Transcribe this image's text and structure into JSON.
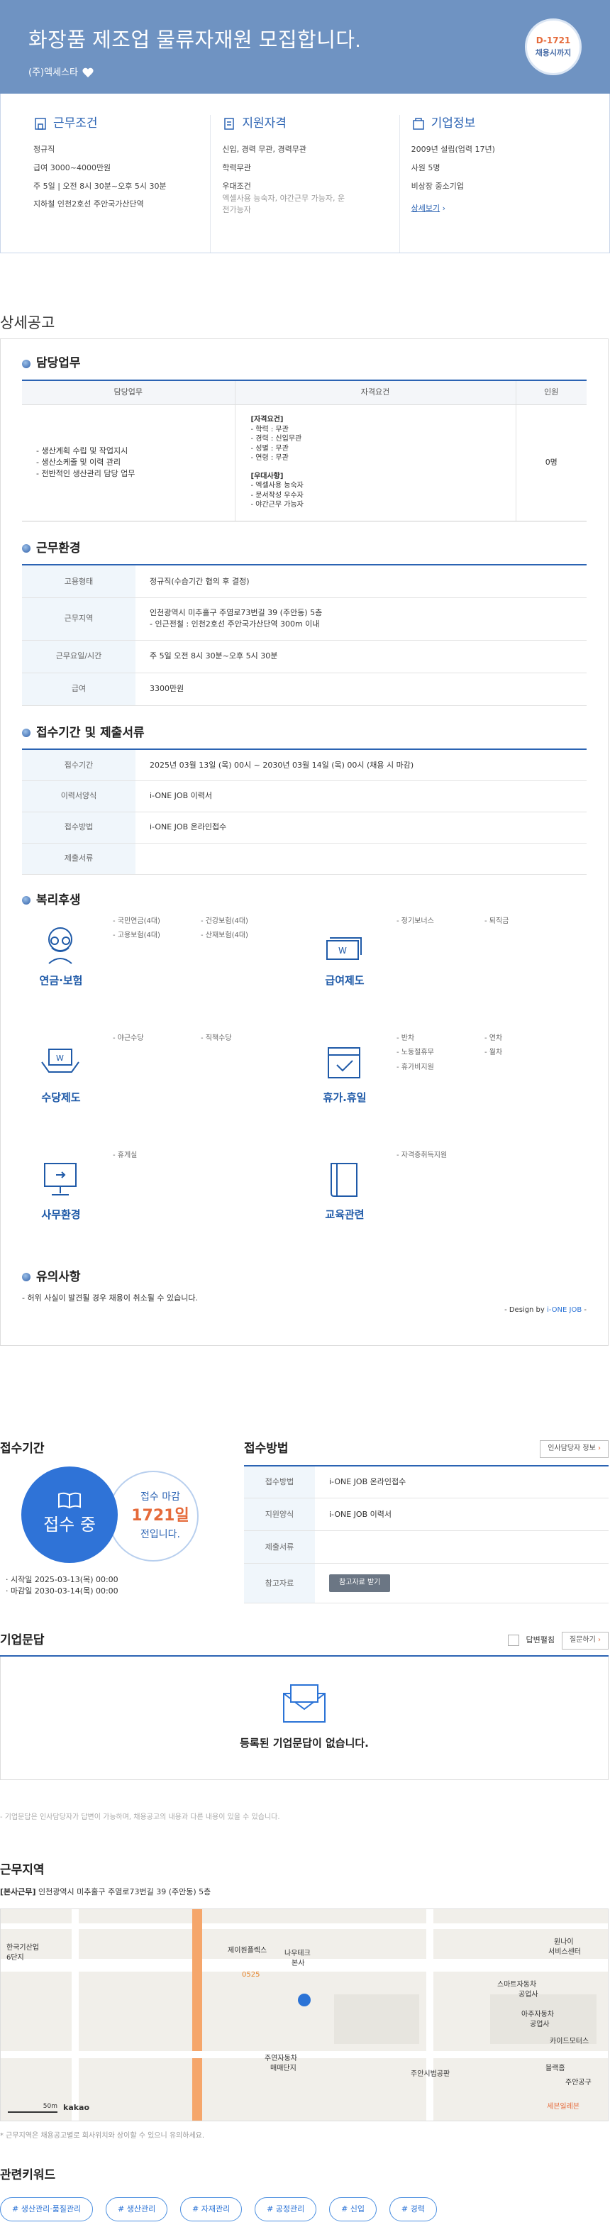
{
  "header": {
    "title": "화장품 제조업 물류자재원 모집합니다.",
    "company": "(주)엑세스타",
    "dday": "D-1721",
    "dday_sub": "채용시까지"
  },
  "summary": {
    "conditions": {
      "title": "근무조건",
      "items": [
        "정규직",
        "급여 3000~4000만원",
        "주 5일 | 오전 8시 30분~오후 5시 30분",
        "지하철 인천2호선 주안국가산단역"
      ]
    },
    "qualifications": {
      "title": "지원자격",
      "items": [
        "신입, 경력 무관, 경력무관",
        "학력무관",
        "우대조건"
      ],
      "sub": "엑셀사용 능숙자, 야간근무 가능자, 운전가능자"
    },
    "company_info": {
      "title": "기업정보",
      "items": [
        "2009년 설립(업력 17년)",
        "사원 5명",
        "비상장 중소기업"
      ],
      "link": "상세보기"
    }
  },
  "detail": {
    "heading": "상세공고",
    "duty": {
      "title": "담당업무",
      "headers": [
        "담당업무",
        "자격요건",
        "인원"
      ],
      "tasks": [
        "- 생산계획 수립 및 작업지시",
        "- 생산소케줄 및 이력 관리",
        "- 전반적인 생산관리 담당 업무"
      ],
      "req_title1": "[자격요건]",
      "req_list1": [
        "- 학력 : 무관",
        "- 경력 : 신입무관",
        "- 성별 : 무관",
        "- 연령 : 무관"
      ],
      "req_title2": "[우대사항]",
      "req_list2": [
        "- 엑셀사용 능숙자",
        "- 문서작성 우수자",
        "- 야간근무 가능자"
      ],
      "count": "0명"
    },
    "environment": {
      "title": "근무환경",
      "rows": [
        {
          "k": "고용형태",
          "v": "정규직(수습기간 협의 후 결정)"
        },
        {
          "k": "근무지역",
          "v": "인천광역시 미추홀구 주염로73번길 39 (주안동) 5층",
          "v2": "- 인근전철 : 인천2호선 주안국가산단역 300m 이내"
        },
        {
          "k": "근무요일/시간",
          "v": "주 5일 오전 8시 30분~오후 5시 30분"
        },
        {
          "k": "급여",
          "v": "3300만원"
        }
      ]
    },
    "apply": {
      "title": "접수기간 및 제출서류",
      "rows": [
        {
          "k": "접수기간",
          "v": "2025년 03월 13일 (목) 00시 ~ 2030년 03월 14일 (목) 00시 (채용 시 마감)"
        },
        {
          "k": "이력서양식",
          "v": "i-ONE JOB 이력서"
        },
        {
          "k": "접수방법",
          "v": "i-ONE JOB 온라인접수"
        },
        {
          "k": "제출서류",
          "v": ""
        }
      ]
    },
    "welfare": {
      "title": "복리후생",
      "items": [
        {
          "label": "연금·보험",
          "icon": "glasses-face-icon",
          "list": [
            "- 국민연금(4대)",
            "- 건강보험(4대)",
            "- 고용보험(4대)",
            "- 산재보험(4대)"
          ]
        },
        {
          "label": "급여제도",
          "icon": "money-stack-icon",
          "list": [
            "- 정기보너스",
            "- 퇴직금"
          ]
        },
        {
          "label": "수당제도",
          "icon": "money-hand-icon",
          "list": [
            "- 야근수당",
            "- 직책수당"
          ]
        },
        {
          "label": "휴가.휴일",
          "icon": "calendar-check-icon",
          "list": [
            "- 반차",
            "- 연차",
            "- 노동절휴무",
            "- 월차",
            "- 휴가비지원"
          ]
        },
        {
          "label": "사무환경",
          "icon": "monitor-icon",
          "list": [
            "- 휴게실"
          ]
        },
        {
          "label": "교육관련",
          "icon": "book-icon",
          "list": [
            "- 자격증취득지원"
          ]
        }
      ]
    },
    "caution": {
      "title": "유의사항",
      "text": "- 허위 사실이 발견될 경우 채용이 취소될 수 있습니다.",
      "design_prefix": "- Design by ",
      "design_brand": "i-ONE JOB",
      "design_suffix": " -"
    }
  },
  "period": {
    "title": "접수기간",
    "status": "접수 중",
    "deadline_label": "접수 마감",
    "deadline_days": "1721일",
    "deadline_suffix": "전입니다.",
    "start": "· 시작일 2025-03-13(목) 00:00",
    "end": "· 마감일 2030-03-14(목) 00:00"
  },
  "method": {
    "title": "접수방법",
    "contact_button": "인사담당자 정보",
    "rows": [
      {
        "k": "접수방법",
        "v": "i-ONE JOB 온라인접수"
      },
      {
        "k": "지원양식",
        "v": "i-ONE JOB 이력서"
      },
      {
        "k": "제출서류",
        "v": ""
      },
      {
        "k": "참고자료",
        "v": ""
      }
    ],
    "reference_button": "참고자료 받기"
  },
  "qna": {
    "title": "기업문답",
    "answered_label": "답변펼침",
    "ask_button": "질문하기",
    "empty": "등록된 기업문답이 없습니다.",
    "note": "- 기업문답은 인사담당자가 답변이 가능하며, 채용공고의 내용과 다른 내용이 있을 수 있습니다."
  },
  "location": {
    "title": "근무지역",
    "tag": "[본사근무]",
    "address": "인천광역시 미추홀구 주염로73번길 39 (주안동) 5층",
    "map_labels": [
      "한국기산업",
      "6단지",
      "제이원플렉스",
      "나우테크",
      "본사",
      "스마트자동차",
      "공업사",
      "아주자동차",
      "공업사",
      "카이드모터스",
      "블랙홈",
      "주안공구",
      "주안시법공판",
      "주연자동차",
      "매매단지",
      "원나이",
      "서비스센터",
      "세븐일레븐"
    ],
    "scale": "50m",
    "brand": "kakao",
    "bus": "0525",
    "note": "* 근무지역은 채용공고별로 회사위치와 상이할 수 있으니 유의하세요."
  },
  "keywords": {
    "title": "관련키워드",
    "items": [
      "# 생산관리·품질관리",
      "# 생산관리",
      "# 자재관리",
      "# 공정관리",
      "# 신입",
      "# 경력"
    ]
  },
  "colors": {
    "accent": "#2b63b3",
    "hero": "#6f93c2",
    "orange": "#e56a3a"
  }
}
